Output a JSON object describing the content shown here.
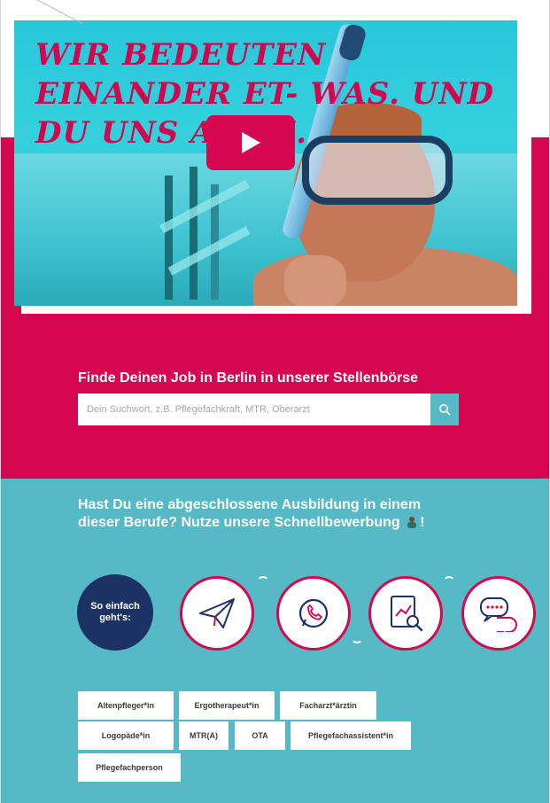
{
  "hero": {
    "headline": "Wir bedeuten einander et- was. Und Du uns auch."
  },
  "job_search": {
    "title": "Finde Deinen Job in Berlin in unserer Stellenbörse",
    "placeholder": "Dein Suchwort, z.B. Pflegefachkraft, MTR, Oberarzt"
  },
  "quick_apply": {
    "title_part1": "Hast Du eine abgeschlossene Ausbildung in einem dieser Berufe? Nutze unsere Schnellbewerbung",
    "title_part2": "!",
    "steps_label": "So einfach geht's:",
    "icons": [
      "paper-plane-icon",
      "whatsapp-icon",
      "document-search-icon",
      "chat-bubble-icon"
    ]
  },
  "tags": [
    "Altenpfleger*in",
    "Ergotherapeut*in",
    "Facharzt*ärztin",
    "Logopäde*in",
    "MTR(A)",
    "OTA",
    "Pflegefachassistent*in",
    "Pflegefachperson"
  ],
  "colors": {
    "magenta": "#d5074f",
    "teal": "#55b9c6",
    "navy": "#1c3264"
  }
}
